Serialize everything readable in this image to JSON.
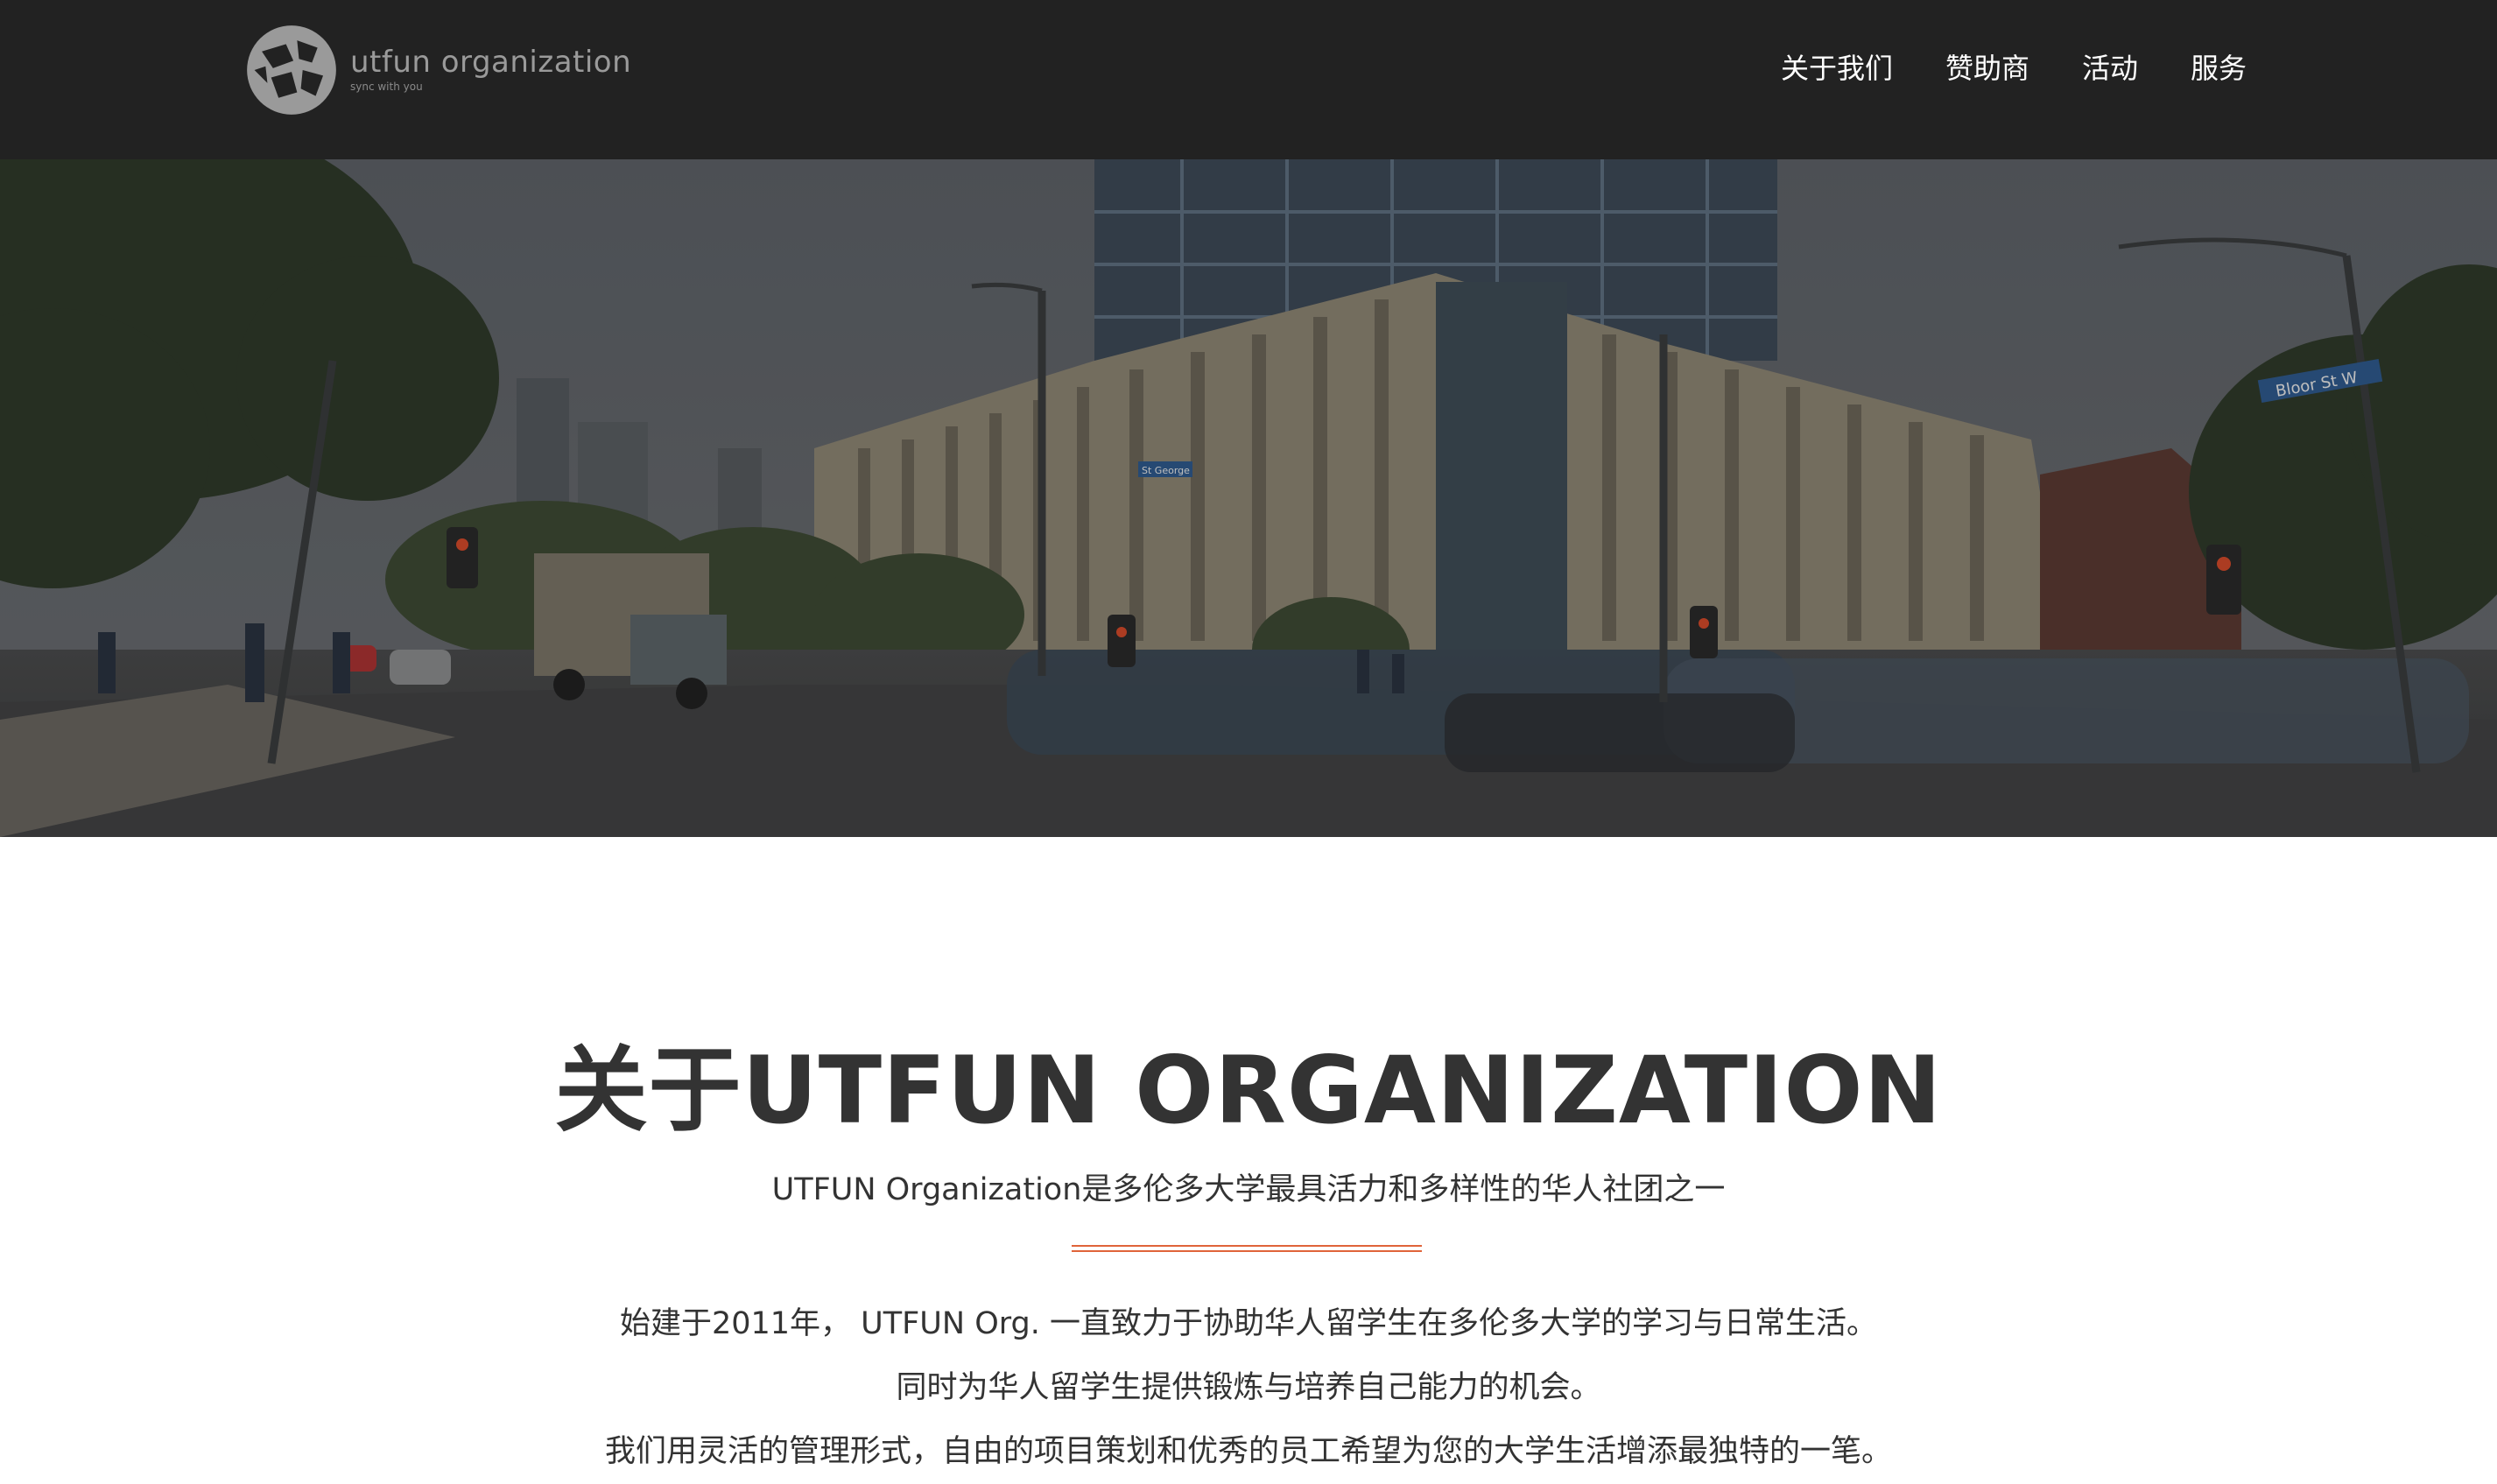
{
  "brand": {
    "name": "utfun organization",
    "tagline": "sync with you",
    "logo_icon": "globe-logo-icon"
  },
  "nav": {
    "items": [
      {
        "label": "关于我们"
      },
      {
        "label": "赞助商"
      },
      {
        "label": "活动"
      },
      {
        "label": "服务"
      }
    ]
  },
  "hero": {
    "scroll_icon": "chevron-down-icon",
    "street_signs": [
      "Bloor St W",
      "St George"
    ]
  },
  "about": {
    "title": "关于UTFUN ORGANIZATION",
    "subtitle": "UTFUN Organization是多伦多大学最具活力和多样性的华人社团之一",
    "paragraphs": [
      "始建于2011年， UTFUN Org. 一直致力于协助华人留学生在多伦多大学的学习与日常生活。",
      "同时为华人留学生提供锻炼与培养自己能力的机会。",
      "我们用灵活的管理形式，自由的项目策划和优秀的员工希望为您的大学生活增添最独特的一笔。"
    ]
  },
  "colors": {
    "nav_background": "#222222",
    "accent": "#e0643a",
    "text": "#333333"
  }
}
